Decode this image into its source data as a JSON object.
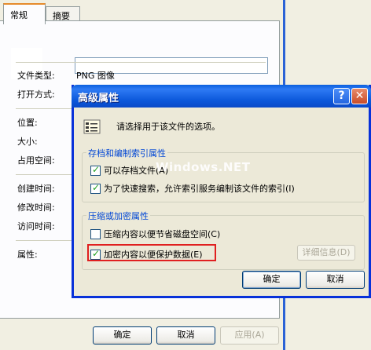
{
  "properties_window": {
    "tabs": [
      "常规",
      "摘要"
    ],
    "labels": {
      "file_type": "文件类型:",
      "open_with": "打开方式:",
      "location": "位置:",
      "size": "大小:",
      "size_on_disk": "占用空间:",
      "created": "创建时间:",
      "modified": "修改时间:",
      "accessed": "访问时间:",
      "attributes": "属性:"
    },
    "values": {
      "file_type": "PNG 图像"
    },
    "buttons": {
      "ok": "确定",
      "cancel": "取消",
      "apply": "应用(A)"
    }
  },
  "advanced_dialog": {
    "title": "高级属性",
    "help_button": "?",
    "close_button": "✕",
    "prompt": "请选择用于该文件的选项。",
    "archive_group": {
      "title": "存档和编制索引属性",
      "options": [
        {
          "label": "可以存档文件(A)",
          "checked": true
        },
        {
          "label": "为了快速搜索，允许索引服务编制该文件的索引(I)",
          "checked": true
        }
      ]
    },
    "compress_group": {
      "title": "压缩或加密属性",
      "options": [
        {
          "label": "压缩内容以便节省磁盘空间(C)",
          "checked": false
        },
        {
          "label": "加密内容以便保护数据(E)",
          "checked": true
        }
      ],
      "details_button": "详细信息(D)"
    },
    "buttons": {
      "ok": "确定",
      "cancel": "取消"
    }
  },
  "watermark": "Windows.NET",
  "colors": {
    "titlebar": "#0a5fdd",
    "highlight_box": "#e02020",
    "group_title": "#0046d5"
  }
}
